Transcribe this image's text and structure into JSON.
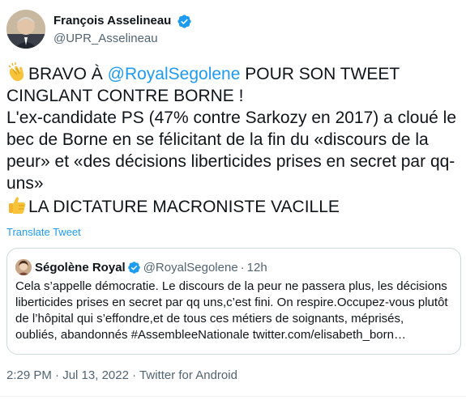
{
  "author": {
    "display_name": "François Asselineau",
    "handle": "@UPR_Asselineau"
  },
  "tweet": {
    "line1_emoji": "clapping-hands-emoji",
    "line1_text_a": "BRAVO À ",
    "line1_mention": "@RoyalSegolene",
    "line1_text_b": " POUR SON TWEET CINGLANT CONTRE BORNE !",
    "line2": "L'ex-candidate PS (47% contre Sarkozy en 2017) a cloué le bec de Borne en se félicitant de la fin du «discours de la peur» et «des décisions liberticides prises en secret par qq-uns»",
    "line3_emoji": "thumbs-up-emoji",
    "line3_text": "LA DICTATURE MACRONISTE VACILLE"
  },
  "translate_label": "Translate Tweet",
  "quote": {
    "display_name": "Ségolène Royal",
    "handle": "@RoyalSegolene",
    "separator": "·",
    "time": "12h",
    "text": "Cela s’appelle démocratie. Le discours de la peur ne passera plus, les décisions liberticides prises en secret par qq uns,c’est fini. On respire.Occupez-vous plutôt de l’hôpital qui s’effondre,et de tous ces métiers de soignants, méprisés, oubliés, abandonnés #AssembleeNationale twitter.com/elisabeth_born…"
  },
  "meta": {
    "time": "2:29 PM",
    "date": "Jul 13, 2022",
    "source": "Twitter for Android",
    "separator": "·"
  },
  "colors": {
    "link": "#1d9bf0",
    "secondary_text": "#536471",
    "border": "#cfd9de"
  }
}
